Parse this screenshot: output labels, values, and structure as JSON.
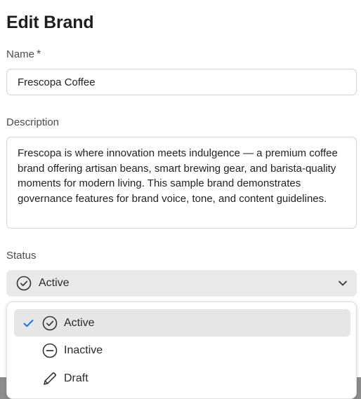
{
  "page": {
    "title": "Edit Brand"
  },
  "name_field": {
    "label": "Name",
    "required_mark": "*",
    "value": "Frescopa Coffee"
  },
  "description_field": {
    "label": "Description",
    "value": "Frescopa is where innovation meets indulgence — a premium coffee brand offering artisan beans, smart brewing gear, and barista-quality moments for modern living. This sample brand demonstrates governance features for brand voice, tone, and content guidelines."
  },
  "status_field": {
    "label": "Status",
    "selected": "Active",
    "selected_icon": "check-circle-icon",
    "options": [
      {
        "label": "Active",
        "icon": "check-circle-icon",
        "selected": true
      },
      {
        "label": "Inactive",
        "icon": "minus-circle-icon",
        "selected": false
      },
      {
        "label": "Draft",
        "icon": "pencil-icon",
        "selected": false
      }
    ]
  },
  "colors": {
    "check_mark": "#1473e6",
    "selected_bg": "#e6e6e6",
    "select_bg": "#e9e9e9"
  }
}
